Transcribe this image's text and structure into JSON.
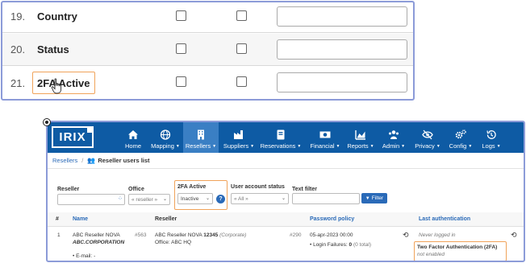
{
  "field_list": {
    "rows": [
      {
        "num": "19.",
        "label": "Country"
      },
      {
        "num": "20.",
        "label": "Status"
      },
      {
        "num": "21.",
        "label": "2FA Active"
      }
    ]
  },
  "app": {
    "logo": "IRIX",
    "nav": [
      {
        "label": "Home",
        "icon": "home-icon",
        "caret": false
      },
      {
        "label": "Mapping",
        "icon": "globe-icon",
        "caret": true
      },
      {
        "label": "Resellers",
        "icon": "building-icon",
        "caret": true,
        "active": true
      },
      {
        "label": "Suppliers",
        "icon": "factory-icon",
        "caret": true
      },
      {
        "label": "Reservations",
        "icon": "book-icon",
        "caret": true
      },
      {
        "label": "Financial",
        "icon": "money-icon",
        "caret": true
      },
      {
        "label": "Reports",
        "icon": "chart-icon",
        "caret": true
      },
      {
        "label": "Admin",
        "icon": "users-icon",
        "caret": true
      },
      {
        "label": "Privacy",
        "icon": "eye-slash-icon",
        "caret": true
      },
      {
        "label": "Config",
        "icon": "gears-icon",
        "caret": true
      },
      {
        "label": "Logs",
        "icon": "history-icon",
        "caret": true
      }
    ],
    "breadcrumb": {
      "parent": "Resellers",
      "separator": "/",
      "current": "Reseller users list"
    },
    "filters": {
      "reseller_label": "Reseller",
      "office_label": "Office",
      "office_value": "« reseller »",
      "twofa_label": "2FA Active",
      "twofa_value": "Inactive",
      "status_label": "User account status",
      "status_value": "« All »",
      "text_label": "Text filter",
      "filter_button": "Filter",
      "help": "?"
    },
    "table": {
      "headers": {
        "num": "#",
        "name": "Name",
        "reseller": "Reseller",
        "password": "Password policy",
        "auth": "Last authentication"
      },
      "row": {
        "num": "1",
        "name": "ABC Reseller NOVA",
        "corp": "ABC.CORPORATION",
        "email": "• E-mail: -",
        "id": "#563",
        "reseller_name": "ABC Reseller NOVA",
        "reseller_num": "12345",
        "reseller_type": "(Corporate)",
        "office": "Office: ABC HQ",
        "policy_id": "#290",
        "policy_date": "05-apr-2023 00:00",
        "login_failures_label": "• Login Failures:",
        "login_failures_value": "0",
        "login_failures_total": "(0 total)",
        "never_logged": "Never logged in",
        "twofa_title": "Two Factor Authentication (2FA)",
        "twofa_status": "not enabled"
      }
    }
  },
  "colors": {
    "navbar": "#0e5ba4",
    "nav_active": "#3a7fc4",
    "link": "#2a6ab8",
    "highlight": "#f0a35a",
    "panel_border": "#8c9bd8"
  }
}
